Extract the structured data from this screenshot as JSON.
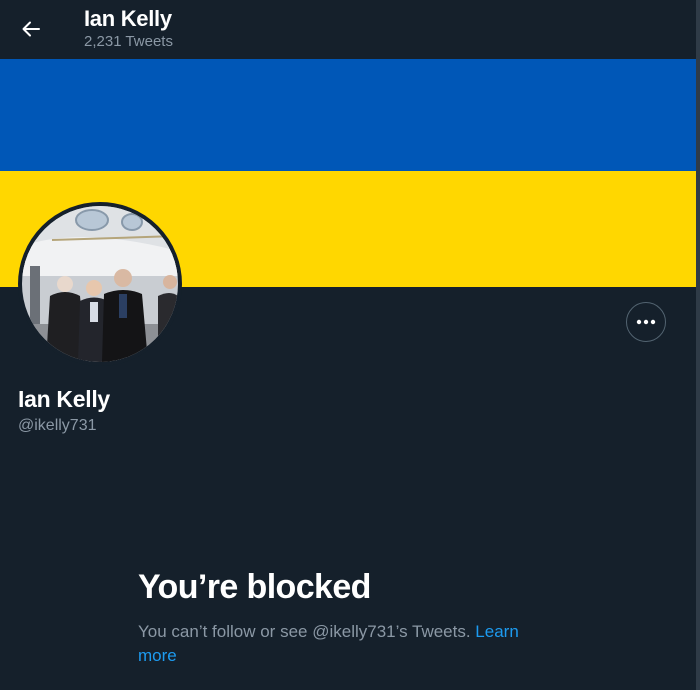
{
  "header": {
    "title": "Ian Kelly",
    "tweet_count": "2,231 Tweets",
    "back_icon": "arrow-left-icon"
  },
  "banner": {
    "top_color": "#0057b7",
    "bottom_color": "#ffd700"
  },
  "profile": {
    "name": "Ian Kelly",
    "handle": "@ikelly731",
    "more_icon": "more-horizontal-icon"
  },
  "blocked": {
    "title": "You’re blocked",
    "message": "You can’t follow or see @ikelly731’s Tweets. ",
    "learn_more": "Learn more"
  },
  "colors": {
    "background": "#15202b",
    "secondary_text": "#8b98a5",
    "link": "#1d9bf0"
  }
}
